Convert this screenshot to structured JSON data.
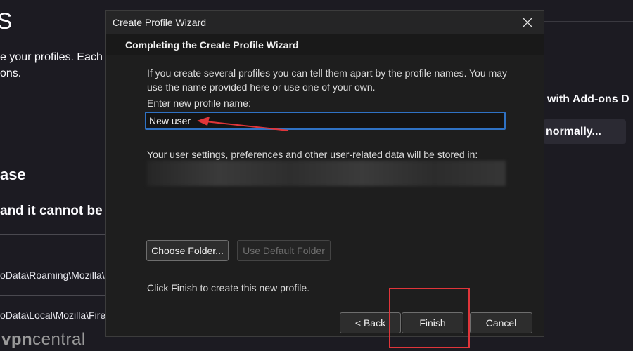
{
  "background": {
    "title_fragment": "S",
    "desc_line1": "e your profiles. Each",
    "desc_line2": "ons.",
    "heading_fragment": "ase",
    "subheading_fragment": "and it cannot be",
    "path1": "oData\\Roaming\\Mozilla\\F",
    "path2": "oData\\Local\\Mozilla\\Firefo",
    "addons_button": "with Add-ons D",
    "normally_button": "normally..."
  },
  "dialog": {
    "title": "Create Profile Wizard",
    "header": "Completing the Create Profile Wizard",
    "intro": "If you create several profiles you can tell them apart by the profile names. You may use the name provided here or use one of your own.",
    "enter_label": "Enter new profile name:",
    "profile_name_value": "New user",
    "stored_label": "Your user settings, preferences and other user-related data will be stored in:",
    "choose_folder": "Choose Folder...",
    "use_default_folder": "Use Default Folder",
    "finish_note": "Click Finish to create this new profile.",
    "back": "< Back",
    "finish": "Finish",
    "cancel": "Cancel"
  },
  "watermark": {
    "part1": "vpn",
    "part2": "central"
  },
  "colors": {
    "accent": "#2f72c4",
    "annotation": "#e0353a"
  }
}
